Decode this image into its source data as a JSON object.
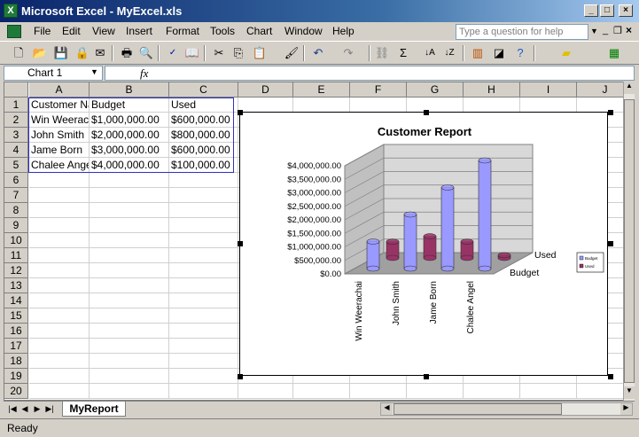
{
  "window": {
    "title": "Microsoft Excel - MyExcel.xls",
    "app_icon_glyph": "X"
  },
  "menu": {
    "items": [
      "File",
      "Edit",
      "View",
      "Insert",
      "Format",
      "Tools",
      "Chart",
      "Window",
      "Help"
    ],
    "ask_placeholder": "Type a question for help"
  },
  "formula_bar": {
    "name_box": "Chart 1",
    "fx_label": "fx"
  },
  "sheet": {
    "columns": [
      "A",
      "B",
      "C",
      "D",
      "E",
      "F",
      "G",
      "H",
      "I",
      "J"
    ],
    "rows": [
      "1",
      "2",
      "3",
      "4",
      "5",
      "6",
      "7",
      "8",
      "9",
      "10",
      "11",
      "12",
      "13",
      "14",
      "15",
      "16",
      "17",
      "18",
      "19",
      "20"
    ],
    "cells": [
      [
        "Customer Name",
        "Budget",
        "Used"
      ],
      [
        "Win Weerachai",
        "$1,000,000.00",
        "$600,000.00"
      ],
      [
        "John Smith",
        "$2,000,000.00",
        "$800,000.00"
      ],
      [
        "Jame Born",
        "$3,000,000.00",
        "$600,000.00"
      ],
      [
        "Chalee Angel",
        "$4,000,000.00",
        "$100,000.00"
      ]
    ],
    "tab_name": "MyReport"
  },
  "status": {
    "text": "Ready"
  },
  "chart_data": {
    "type": "bar",
    "title": "Customer Report",
    "categories": [
      "Win Weerachai",
      "John Smith",
      "Jame Born",
      "Chalee Angel"
    ],
    "series": [
      {
        "name": "Budget",
        "values": [
          1000000,
          2000000,
          3000000,
          4000000
        ],
        "color": "#9999ff"
      },
      {
        "name": "Used",
        "values": [
          600000,
          800000,
          600000,
          100000
        ],
        "color": "#993366"
      }
    ],
    "ytick_labels": [
      "$4,000,000.00",
      "$3,500,000.00",
      "$3,000,000.00",
      "$2,500,000.00",
      "$2,000,000.00",
      "$1,500,000.00",
      "$1,000,000.00",
      "$500,000.00",
      "$0.00"
    ],
    "ylim": [
      0,
      4000000
    ],
    "depth_labels": [
      "Used",
      "Budget"
    ],
    "legend_placement": "right"
  }
}
